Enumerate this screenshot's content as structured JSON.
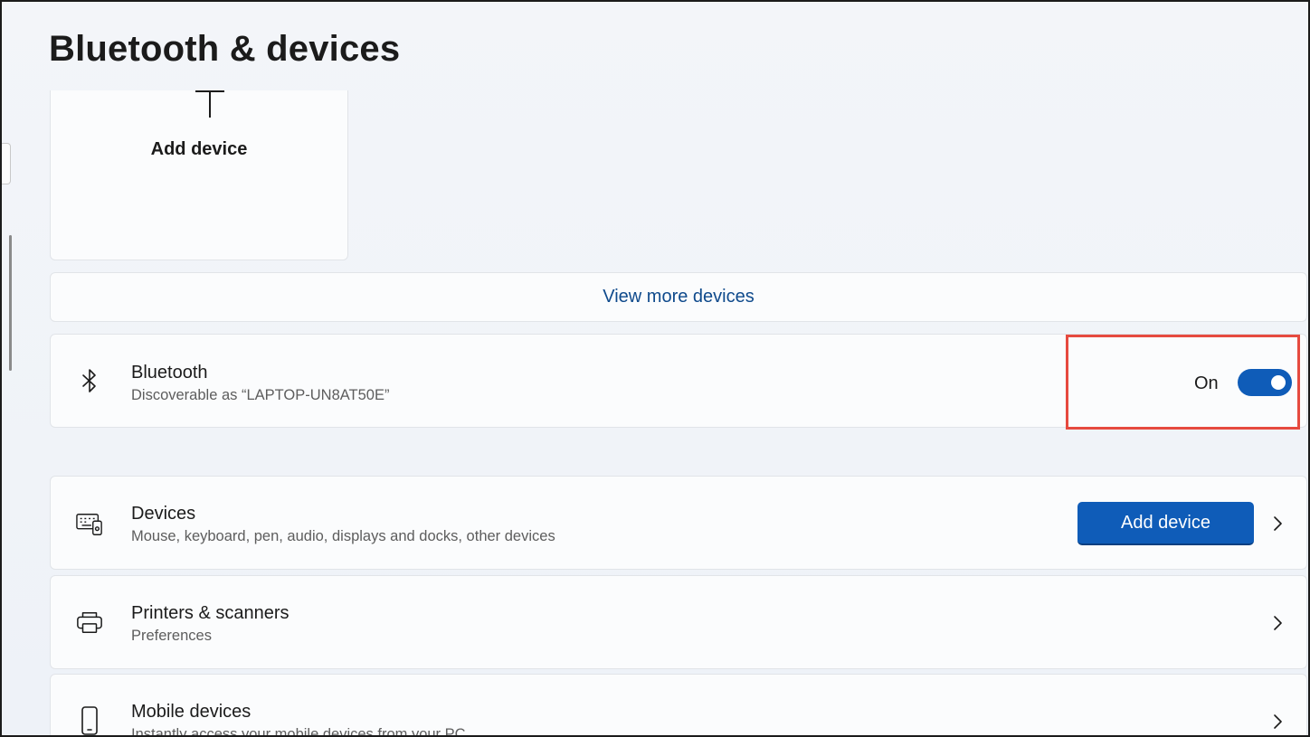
{
  "header": {
    "title": "Bluetooth & devices"
  },
  "add_tile": {
    "label": "Add device",
    "icon": "plus-icon"
  },
  "view_more": {
    "label": "View more devices"
  },
  "bluetooth": {
    "title": "Bluetooth",
    "subtitle": "Discoverable as “LAPTOP-UN8AT50E”",
    "state_label": "On",
    "enabled": true,
    "icon": "bluetooth-icon"
  },
  "devices": {
    "title": "Devices",
    "subtitle": "Mouse, keyboard, pen, audio, displays and docks, other devices",
    "button_label": "Add device",
    "icon": "devices-icon"
  },
  "printers": {
    "title": "Printers & scanners",
    "subtitle": "Preferences",
    "icon": "printer-icon"
  },
  "mobile": {
    "title": "Mobile devices",
    "subtitle": "Instantly access your mobile devices from your PC",
    "icon": "phone-icon"
  },
  "colors": {
    "accent": "#0f5cb8",
    "highlight": "#e64a3f",
    "link": "#0f4a8c"
  }
}
